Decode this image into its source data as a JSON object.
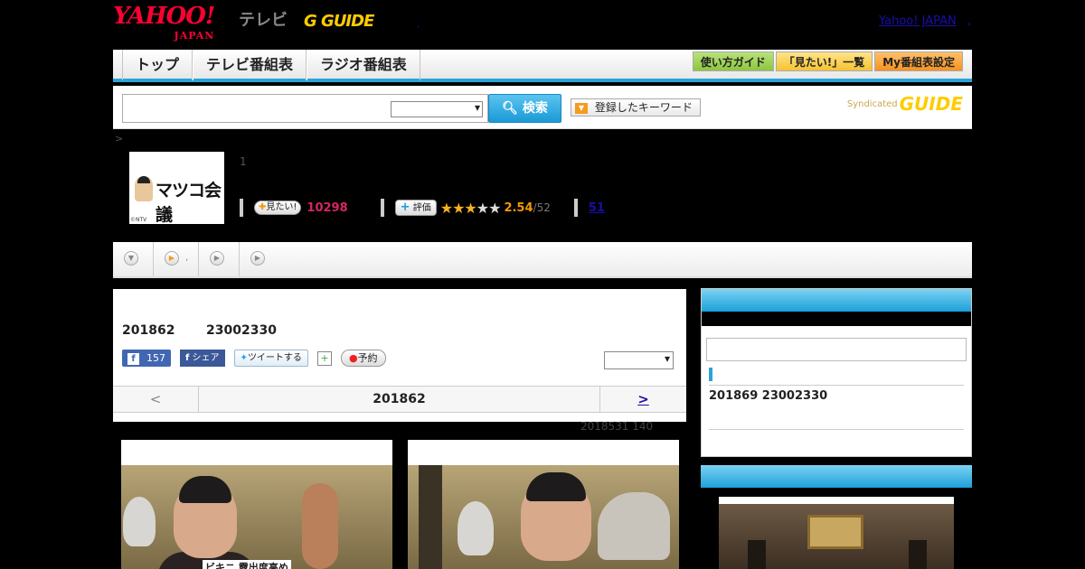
{
  "header": {
    "yahoo_logo": "YAHOO!",
    "yahoo_sub": "JAPAN",
    "tv_label": "テレビ",
    "gguide_logo": "G GUIDE",
    "yahoo_japan_link": "Yahoo! JAPAN",
    "link_separator": ",",
    "small_dot": ","
  },
  "nav": {
    "tabs": [
      {
        "label": "トップ"
      },
      {
        "label": "テレビ番組表"
      },
      {
        "label": "ラジオ番組表"
      }
    ],
    "buttons": [
      {
        "label": "使い方ガイド"
      },
      {
        "label": "「見たい!」一覧"
      },
      {
        "label": "My番組表設定"
      }
    ]
  },
  "search": {
    "input_value": "",
    "select_value": "",
    "button_label": "検索",
    "keyword_button": "登録したキーワード",
    "syndicated_text": "Syndicated",
    "syndicated_logo": "GUIDE"
  },
  "breadcrumb": ">",
  "program": {
    "thumb_title": "マツコ会議",
    "thumb_copyright": "©NTV",
    "info_line": "1",
    "mitai_label": "見たい!",
    "mitai_count": "10298",
    "hyoka_label": "評価",
    "rating": "2.54",
    "rating_total": "/52",
    "rating_stars_filled": 2.5,
    "rating_stars_total": 5,
    "link_count": "51"
  },
  "tabstrip": {
    "item2_suffix": ","
  },
  "episode": {
    "date": "201862",
    "time": "23002330",
    "fb_like_count": "157",
    "fb_share": "シェア",
    "tweet": "ツイートする",
    "reserve": "予約",
    "select_value": "",
    "prev": "<",
    "current": "201862",
    "next": ">",
    "updated": "2018531  140"
  },
  "photos": {
    "caption1": "ビキニ 露出度高め"
  },
  "sidebar": {
    "search_value": "",
    "next_airing": "201869  23002330"
  },
  "colors": {
    "accent_blue": "#2aa4d8",
    "mitai_pink": "#d62760",
    "rating_orange": "#f39800"
  }
}
